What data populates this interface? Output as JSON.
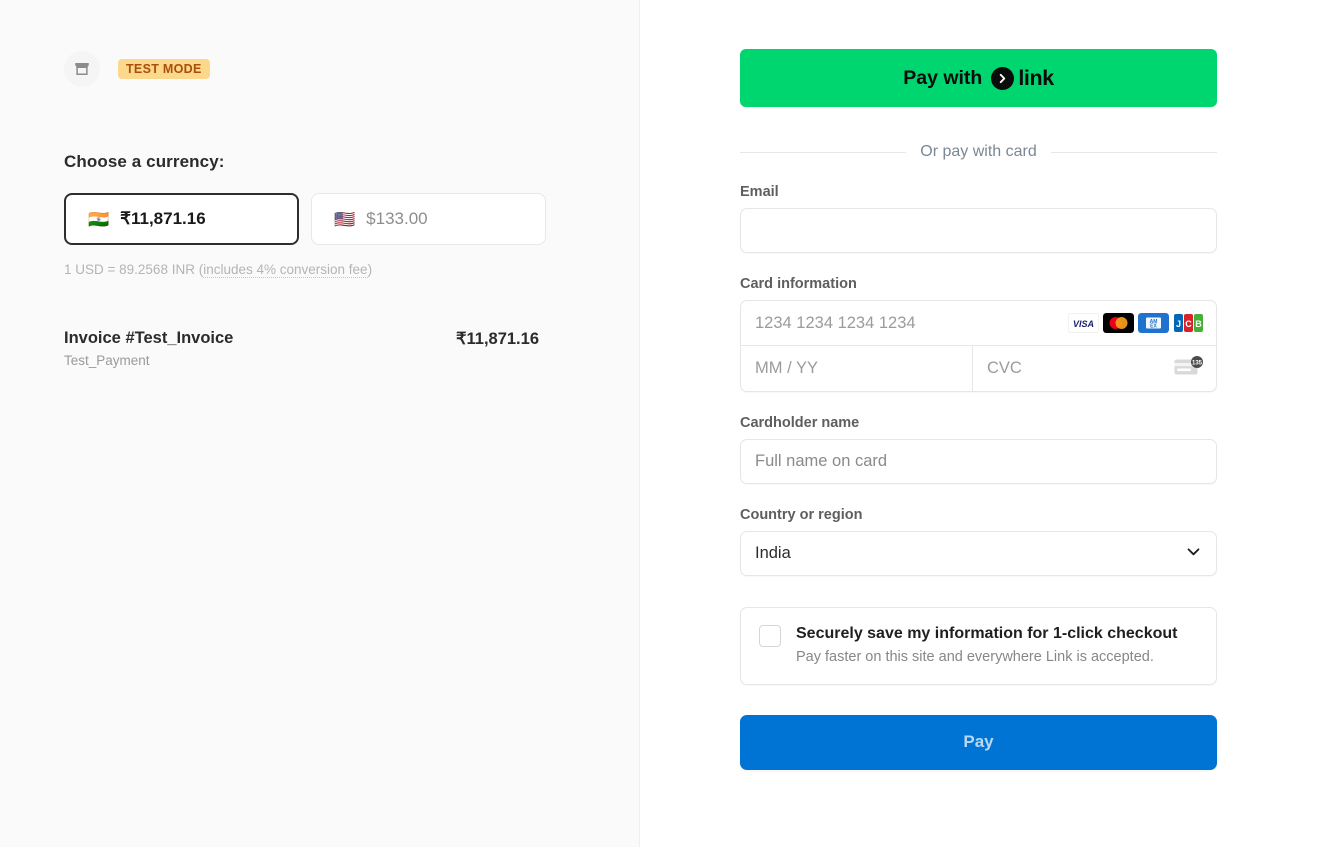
{
  "merchant": {
    "icon": "storefront-icon",
    "test_mode_badge": "TEST MODE"
  },
  "currency_section": {
    "heading": "Choose a currency:",
    "options": [
      {
        "flag": "🇮🇳",
        "amount": "₹11,871.16",
        "selected": true
      },
      {
        "flag": "🇺🇸",
        "amount": "$133.00",
        "selected": false
      }
    ],
    "fx_note_prefix": "1 USD = 89.2568 INR (",
    "fx_note_link": "includes 4% conversion fee",
    "fx_note_suffix": ")"
  },
  "invoice": {
    "title": "Invoice #Test_Invoice",
    "subtitle": "Test_Payment",
    "amount": "₹11,871.16"
  },
  "payment": {
    "link_button_prefix": "Pay with",
    "link_button_word": "link",
    "divider_text": "Or pay with card",
    "email_label": "Email",
    "email_value": "",
    "email_placeholder": "",
    "card_label": "Card information",
    "card_number_placeholder": "1234 1234 1234 1234",
    "card_number_value": "",
    "expiry_placeholder": "MM / YY",
    "expiry_value": "",
    "cvc_placeholder": "CVC",
    "cvc_value": "",
    "cvc_hint_digits": "135",
    "card_brands": [
      "visa-icon",
      "mastercard-icon",
      "amex-icon",
      "jcb-icon"
    ],
    "cardholder_label": "Cardholder name",
    "cardholder_placeholder": "Full name on card",
    "cardholder_value": "",
    "country_label": "Country or region",
    "country_value": "India",
    "save_checkbox_checked": false,
    "save_title": "Securely save my information for 1-click checkout",
    "save_subtitle": "Pay faster on this site and everywhere Link is accepted.",
    "pay_button_label": "Pay"
  },
  "colors": {
    "link_green": "#00d66f",
    "pay_blue": "#0074d4",
    "test_badge_bg": "#fcd88d",
    "test_badge_text": "#a94f09"
  }
}
